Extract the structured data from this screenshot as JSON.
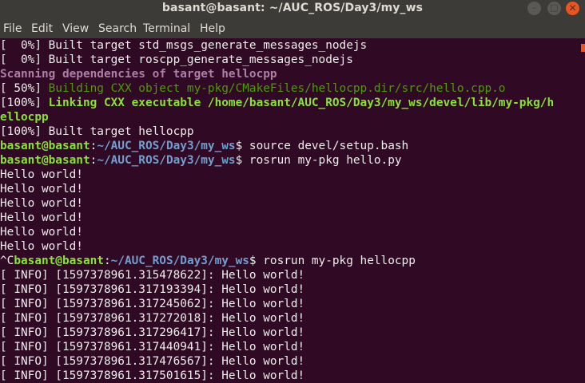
{
  "window": {
    "title": "basant@basant: ~/AUC_ROS/Day3/my_ws",
    "minimize_glyph": "–",
    "maximize_glyph": "□",
    "close_glyph": "✕",
    "accent": "#e95420"
  },
  "menu": {
    "file": "File",
    "edit": "Edit",
    "view": "View",
    "search": "Search",
    "terminal": "Terminal",
    "help": "Help"
  },
  "terminal": {
    "background": "#300a24",
    "lines": {
      "l1": "[  0%] Built target std_msgs_generate_messages_nodejs",
      "l2": "[  0%] Built target roscpp_generate_messages_nodejs",
      "l3": "Scanning dependencies of target hellocpp",
      "l4_prefix": "[ 50%] ",
      "l4_msg": "Building CXX object my-pkg/CMakeFiles/hellocpp.dir/src/hello.cpp.o",
      "l5_prefix": "[100%] ",
      "l5_msg": "Linking CXX executable /home/basant/AUC_ROS/Day3/my_ws/devel/lib/my-pkg/h",
      "l6": "ellocpp",
      "l7": "[100%] Built target hellocpp",
      "p1_user": "basant@basant",
      "p1_colon": ":",
      "p1_path": "~/AUC_ROS/Day3/my_ws",
      "p1_cmd": "$ source devel/setup.bash",
      "p2_user": "basant@basant",
      "p2_colon": ":",
      "p2_path": "~/AUC_ROS/Day3/my_ws",
      "p2_cmd": "$ rosrun my-pkg hello.py",
      "h1": "Hello world!",
      "h2": "Hello world!",
      "h3": "Hello world!",
      "h4": "Hello world!",
      "h5": "Hello world!",
      "h6": "Hello world!",
      "p3_ctrl": "^C",
      "p3_user": "basant@basant",
      "p3_colon": ":",
      "p3_path": "~/AUC_ROS/Day3/my_ws",
      "p3_cmd": "$ rosrun my-pkg hellocpp",
      "i1": "[ INFO] [1597378961.315478622]: Hello world!",
      "i2": "[ INFO] [1597378961.317193394]: Hello world!",
      "i3": "[ INFO] [1597378961.317245062]: Hello world!",
      "i4": "[ INFO] [1597378961.317272018]: Hello world!",
      "i5": "[ INFO] [1597378961.317296417]: Hello world!",
      "i6": "[ INFO] [1597378961.317440941]: Hello world!",
      "i7": "[ INFO] [1597378961.317476567]: Hello world!",
      "i8": "[ INFO] [1597378961.317501615]: Hello world!"
    }
  }
}
